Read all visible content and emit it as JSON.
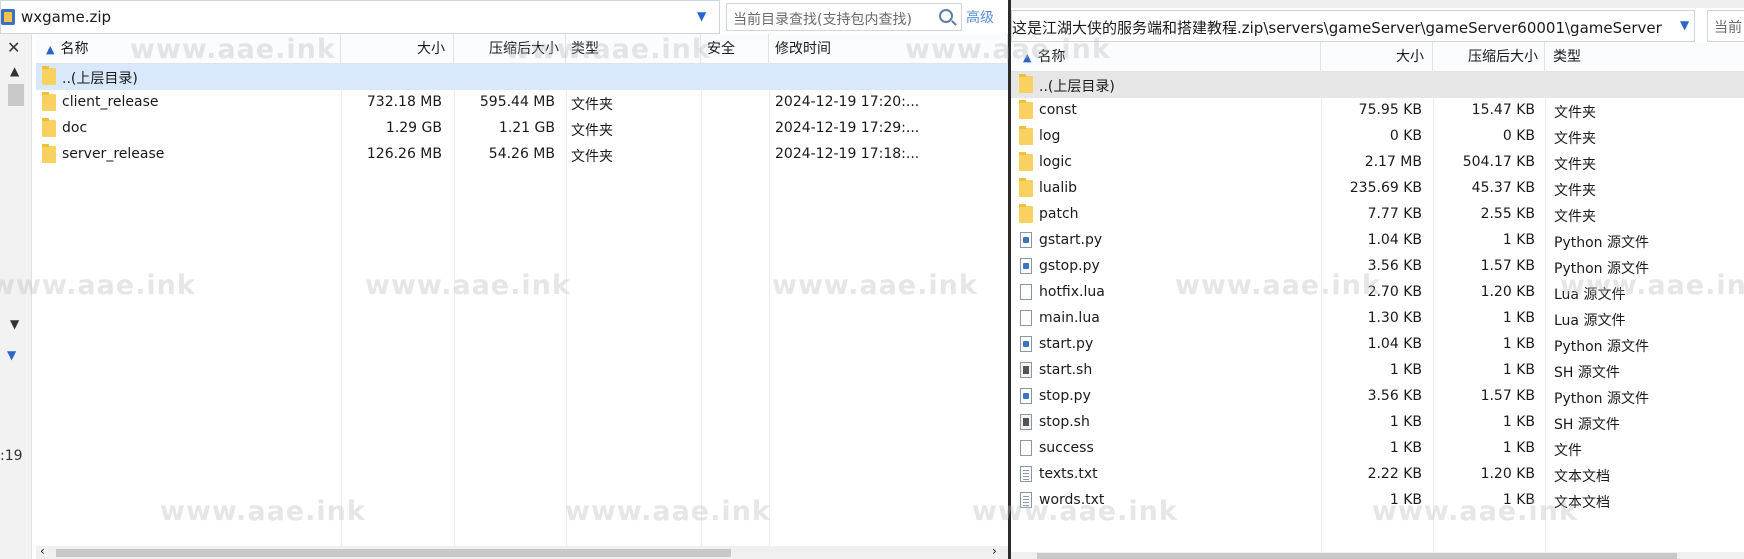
{
  "left": {
    "archive_name": "wxgame.zip",
    "search_placeholder": "当前目录查找(支持包内查找)",
    "advanced_label": "高级",
    "sidebar_text": ":19",
    "columns": [
      "名称",
      "大小",
      "压缩后大小",
      "类型",
      "安全",
      "修改时间"
    ],
    "rows": [
      {
        "name": "..(上层目录)",
        "size": "",
        "packed": "",
        "type": "",
        "safety": "",
        "modified": ""
      },
      {
        "name": "client_release",
        "size": "732.18 MB",
        "packed": "595.44 MB",
        "type": "文件夹",
        "safety": "",
        "modified": "2024-12-19 17:20:..."
      },
      {
        "name": "doc",
        "size": "1.29 GB",
        "packed": "1.21 GB",
        "type": "文件夹",
        "safety": "",
        "modified": "2024-12-19 17:29:..."
      },
      {
        "name": "server_release",
        "size": "126.26 MB",
        "packed": "54.26 MB",
        "type": "文件夹",
        "safety": "",
        "modified": "2024-12-19 17:18:..."
      }
    ]
  },
  "right": {
    "path": "这是江湖大侠的服务端和搭建教程.zip\\servers\\gameServer\\gameServer60001\\gameServer",
    "search_placeholder": "当前目",
    "columns": [
      "名称",
      "大小",
      "压缩后大小",
      "类型"
    ],
    "rows": [
      {
        "name": "..(上层目录)",
        "size": "",
        "packed": "",
        "type": "",
        "icon": "folder"
      },
      {
        "name": "const",
        "size": "75.95 KB",
        "packed": "15.47 KB",
        "type": "文件夹",
        "icon": "folder"
      },
      {
        "name": "log",
        "size": "0 KB",
        "packed": "0 KB",
        "type": "文件夹",
        "icon": "folder"
      },
      {
        "name": "logic",
        "size": "2.17 MB",
        "packed": "504.17 KB",
        "type": "文件夹",
        "icon": "folder"
      },
      {
        "name": "lualib",
        "size": "235.69 KB",
        "packed": "45.37 KB",
        "type": "文件夹",
        "icon": "folder"
      },
      {
        "name": "patch",
        "size": "7.77 KB",
        "packed": "2.55 KB",
        "type": "文件夹",
        "icon": "folder"
      },
      {
        "name": "gstart.py",
        "size": "1.04 KB",
        "packed": "1 KB",
        "type": "Python 源文件",
        "icon": "py"
      },
      {
        "name": "gstop.py",
        "size": "3.56 KB",
        "packed": "1.57 KB",
        "type": "Python 源文件",
        "icon": "py"
      },
      {
        "name": "hotfix.lua",
        "size": "2.70 KB",
        "packed": "1.20 KB",
        "type": "Lua 源文件",
        "icon": "file"
      },
      {
        "name": "main.lua",
        "size": "1.30 KB",
        "packed": "1 KB",
        "type": "Lua 源文件",
        "icon": "file"
      },
      {
        "name": "start.py",
        "size": "1.04 KB",
        "packed": "1 KB",
        "type": "Python 源文件",
        "icon": "py"
      },
      {
        "name": "start.sh",
        "size": "1 KB",
        "packed": "1 KB",
        "type": "SH 源文件",
        "icon": "sh"
      },
      {
        "name": "stop.py",
        "size": "3.56 KB",
        "packed": "1.57 KB",
        "type": "Python 源文件",
        "icon": "py"
      },
      {
        "name": "stop.sh",
        "size": "1 KB",
        "packed": "1 KB",
        "type": "SH 源文件",
        "icon": "sh"
      },
      {
        "name": "success",
        "size": "1 KB",
        "packed": "1 KB",
        "type": "文件",
        "icon": "file"
      },
      {
        "name": "texts.txt",
        "size": "2.22 KB",
        "packed": "1.20 KB",
        "type": "文本文档",
        "icon": "txt"
      },
      {
        "name": "words.txt",
        "size": "1 KB",
        "packed": "1 KB",
        "type": "文本文档",
        "icon": "txt"
      }
    ]
  },
  "watermark": "www.aae.ink"
}
